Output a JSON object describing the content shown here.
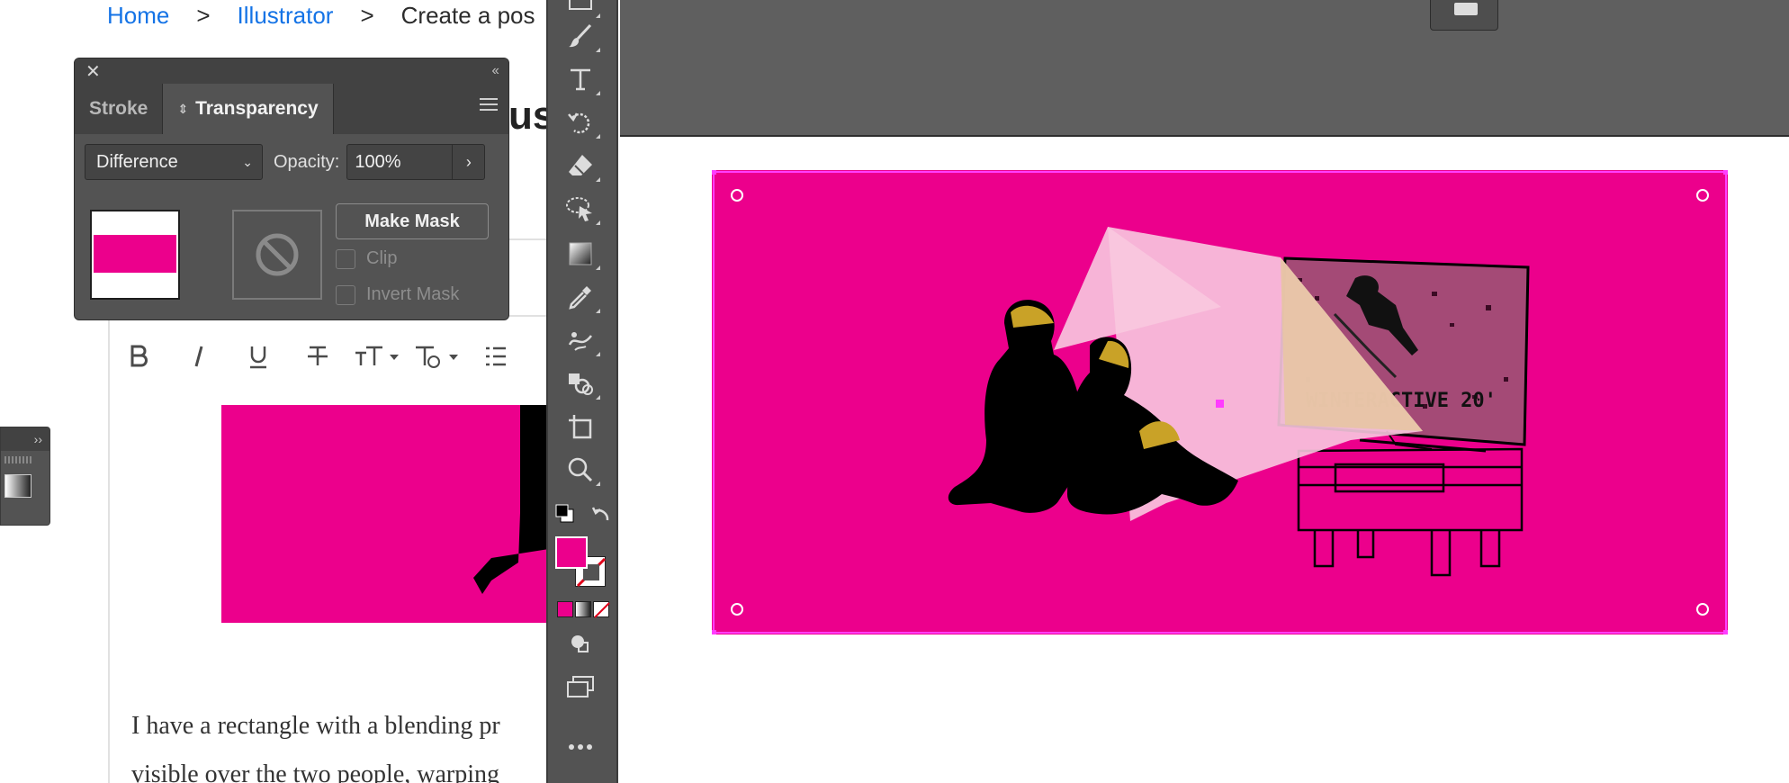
{
  "breadcrumb": {
    "home": "Home",
    "section": "Illustrator",
    "current": "Create a pos",
    "separator": ">"
  },
  "post": {
    "title_fragment": "us",
    "text_line1": "I have a rectangle with a blending pr",
    "text_line2": "visible over the two people, warping"
  },
  "editor_toolbar": {
    "bold": "B",
    "italic": "I",
    "underline": "U",
    "strike": "T",
    "text_size": "тT",
    "text_style": "T"
  },
  "transparency_panel": {
    "tabs": [
      "Stroke",
      "Transparency"
    ],
    "active_tab": "Transparency",
    "blend_mode": "Difference",
    "opacity_label": "Opacity:",
    "opacity_value": "100%",
    "make_mask_label": "Make Mask",
    "clip_label": "Clip",
    "invert_mask_label": "Invert Mask",
    "thumbnail_fill": "#ec008c"
  },
  "tools": [
    "rectangle-tool",
    "paintbrush-tool",
    "type-tool",
    "rotate-tool",
    "eraser-tool",
    "lasso-select-tool",
    "gradient-tool",
    "eyedropper-tool",
    "puppet-warp-tool",
    "shape-builder-tool",
    "artboard-tool",
    "zoom-tool"
  ],
  "swatches": {
    "fill_color": "#ec008c",
    "stroke": "none"
  },
  "artwork": {
    "background_color": "#ec008c",
    "tv_text": "WINTERACTIVE 20'"
  },
  "colors": {
    "brand_pink": "#ec008c",
    "panel_bg": "#535353",
    "panel_dark": "#424242",
    "link_blue": "#1473e6",
    "selection": "#ff3dff"
  }
}
